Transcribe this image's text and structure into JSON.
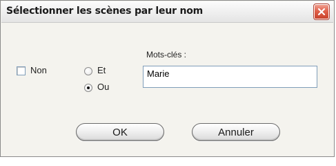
{
  "window": {
    "title": "Sélectionner les scènes par leur nom"
  },
  "options": {
    "not_label": "Non",
    "not_checked": false,
    "operator": {
      "and_label": "Et",
      "or_label": "Ou",
      "selected": "Ou"
    }
  },
  "keywords": {
    "label": "Mots-clés :",
    "value": "Marie"
  },
  "buttons": {
    "ok_label": "OK",
    "cancel_label": "Annuler"
  },
  "colors": {
    "close_button": "#e0604a",
    "dialog_background": "#f4f3ee",
    "field_border": "#7f9db9"
  },
  "icons": {
    "close": "close-x-icon"
  }
}
